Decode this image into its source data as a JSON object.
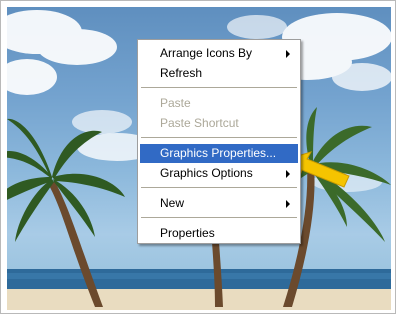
{
  "context_menu": {
    "items": [
      {
        "label": "Arrange Icons By",
        "has_submenu": true,
        "disabled": false,
        "highlighted": false
      },
      {
        "label": "Refresh",
        "has_submenu": false,
        "disabled": false,
        "highlighted": false
      },
      {
        "label": "Paste",
        "has_submenu": false,
        "disabled": true,
        "highlighted": false
      },
      {
        "label": "Paste Shortcut",
        "has_submenu": false,
        "disabled": true,
        "highlighted": false
      },
      {
        "label": "Graphics Properties...",
        "has_submenu": false,
        "disabled": false,
        "highlighted": true
      },
      {
        "label": "Graphics Options",
        "has_submenu": true,
        "disabled": false,
        "highlighted": false
      },
      {
        "label": "New",
        "has_submenu": true,
        "disabled": false,
        "highlighted": false
      },
      {
        "label": "Properties",
        "has_submenu": false,
        "disabled": false,
        "highlighted": false
      }
    ]
  },
  "colors": {
    "highlight": "#316ac5",
    "disabled_text": "#aca899",
    "callout_arrow": "#f5c400"
  },
  "icons": {
    "submenu_indicator": "triangle-right",
    "callout": "yellow-arrow"
  }
}
